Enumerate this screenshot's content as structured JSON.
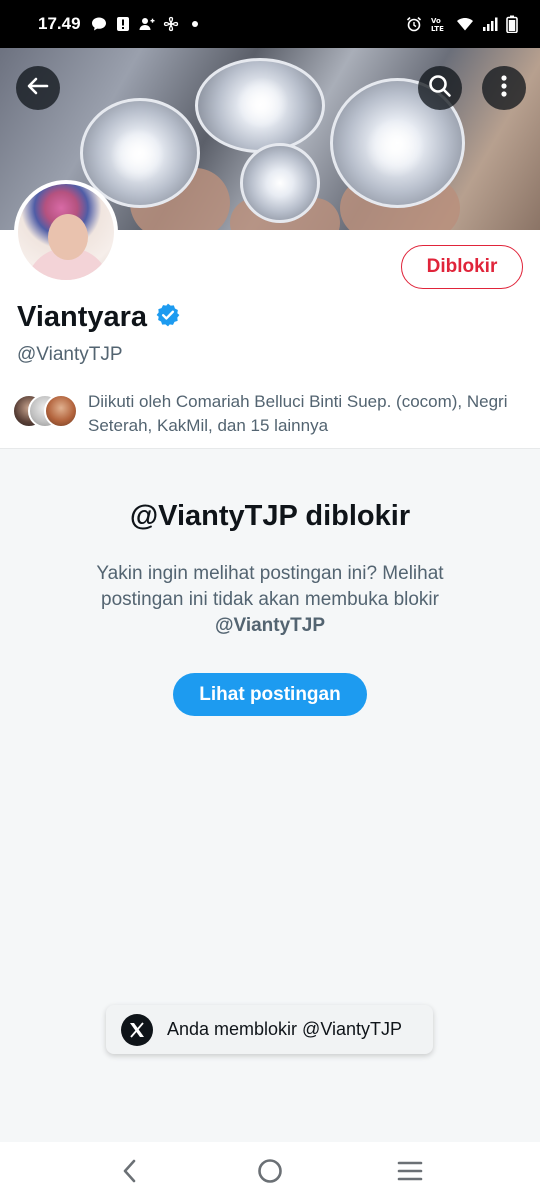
{
  "status_bar": {
    "time": "17.49",
    "icons_left": [
      "chat-bubble-icon",
      "alert-icon",
      "person-add-icon",
      "fan-icon",
      "dot-icon"
    ],
    "icons_right": [
      "alarm-icon",
      "volte-icon",
      "wifi-icon",
      "signal-icon",
      "battery-icon"
    ],
    "volte_label": "VoLTE"
  },
  "header": {
    "back_icon": "arrow-left-icon",
    "search_icon": "search-icon",
    "more_icon": "more-vertical-icon"
  },
  "profile": {
    "display_name": "Viantyara",
    "verified": true,
    "handle": "@ViantyTJP",
    "blocked_button_label": "Diblokir",
    "followed_by_text": "Diikuti oleh Comariah Belluci Binti Suep. (cocom), Negri Seterah, KakMil, dan 15 lainnya"
  },
  "blocked_notice": {
    "title": "@ViantyTJP diblokir",
    "description": "Yakin ingin melihat postingan ini? Melihat postingan ini tidak akan membuka blokir",
    "description_handle": "@ViantyTJP",
    "button_label": "Lihat postingan"
  },
  "toast": {
    "text": "Anda memblokir @ViantyTJP",
    "icon": "x-logo-icon"
  },
  "nav_bar": {
    "items": [
      "back-nav-icon",
      "home-nav-icon",
      "recents-nav-icon"
    ]
  },
  "colors": {
    "accent_blue": "#1d9bf0",
    "blocked_red": "#e0243a",
    "text_primary": "#0f1419",
    "text_secondary": "#536471"
  }
}
